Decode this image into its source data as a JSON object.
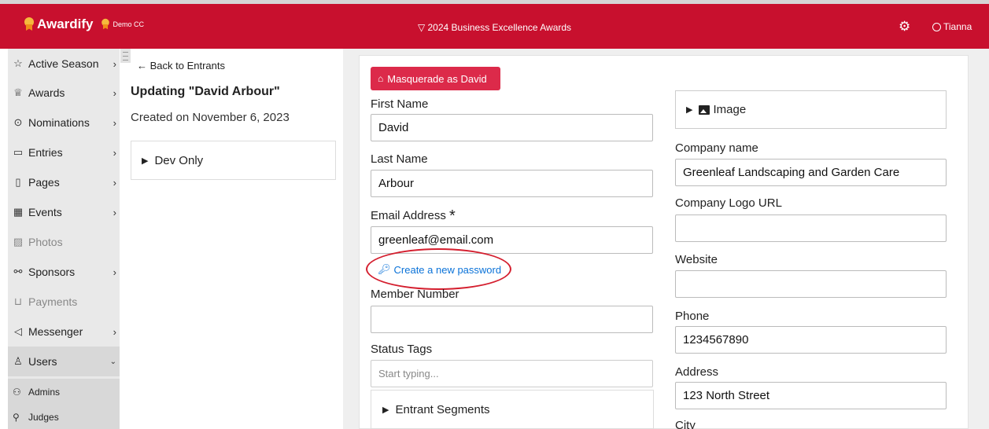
{
  "header": {
    "logo_text": "Awardify",
    "tenant": "Demo CC",
    "season_title": "▽ 2024 Business Excellence Awards",
    "user_name": "Tianna",
    "accent_color": "#c8102e"
  },
  "sidebar": {
    "items": [
      {
        "label": "Active Season",
        "icon": "star-icon"
      },
      {
        "label": "Awards",
        "icon": "trophy-icon"
      },
      {
        "label": "Nominations",
        "icon": "check-circle-icon"
      },
      {
        "label": "Entries",
        "icon": "inbox-icon"
      },
      {
        "label": "Pages",
        "icon": "page-icon"
      },
      {
        "label": "Events",
        "icon": "calendar-icon"
      },
      {
        "label": "Photos",
        "icon": "photo-icon"
      },
      {
        "label": "Sponsors",
        "icon": "handshake-icon"
      },
      {
        "label": "Payments",
        "icon": "cart-icon"
      },
      {
        "label": "Messenger",
        "icon": "send-icon"
      },
      {
        "label": "Users",
        "icon": "user-icon"
      }
    ],
    "subitems": [
      {
        "label": "Admins",
        "icon": "admins-icon"
      },
      {
        "label": "Judges",
        "icon": "gavel-icon"
      }
    ]
  },
  "entrant": {
    "back_label": "← Back to Entrants",
    "heading": "Updating \"David Arbour\"",
    "created": "Created on November 6, 2023",
    "dev_only": "Dev Only"
  },
  "form": {
    "masquerade_label": "Masquerade as David",
    "first_name_label": "First Name",
    "first_name_value": "David",
    "last_name_label": "Last Name",
    "last_name_value": "Arbour",
    "email_label": "Email Address",
    "email_required": "*",
    "email_value": "greenleaf@email.com",
    "password_link": "Create a new password",
    "member_label": "Member Number",
    "member_value": "",
    "status_tags_label": "Status Tags",
    "status_tags_placeholder": "Start typing...",
    "segments_label": "Entrant Segments",
    "image_label": "Image",
    "company_label": "Company name",
    "company_value": "Greenleaf Landscaping and Garden Care",
    "logo_url_label": "Company Logo URL",
    "logo_url_value": "",
    "website_label": "Website",
    "website_value": "",
    "phone_label": "Phone",
    "phone_value": "1234567890",
    "address_label": "Address",
    "address_value": "123 North Street",
    "city_label": "City"
  }
}
